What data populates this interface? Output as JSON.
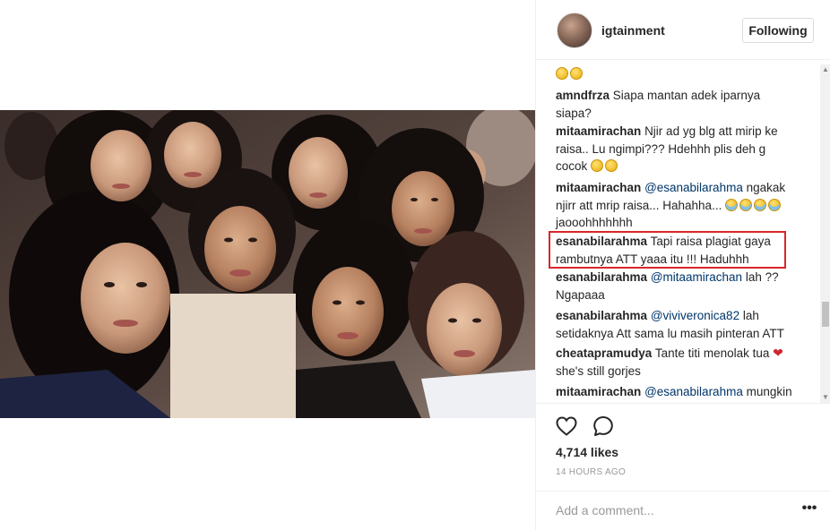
{
  "header": {
    "username": "igtainment",
    "follow_label": "Following"
  },
  "comments": [
    {
      "user": "",
      "parts": [],
      "emoji": [
        "yellow",
        "yellow"
      ]
    },
    {
      "user": "amndfrza",
      "line1": "Siapa mantan adek iparnya",
      "line2": "siapa?"
    },
    {
      "user": "mitaamirachan",
      "line1": "Njir ad yg blg att mirip ke",
      "line2": "raisa.. Lu ngimpi??? Hdehhh plis deh g",
      "line3": "cocok"
    },
    {
      "user": "mitaamirachan",
      "mention": "@esanabilarahma",
      "line1": "ngakak",
      "line2": "njirr att mrip raisa... Hahahha...",
      "line3": "jaooohhhhhhh"
    },
    {
      "user": "esanabilarahma",
      "line1": "Tapi raisa plagiat gaya",
      "line2": "rambutnya ATT yaaa itu !!! Haduhhh"
    },
    {
      "user": "esanabilarahma",
      "mention": "@mitaamirachan",
      "line1": "lah ??",
      "line2": "Ngapaaa"
    },
    {
      "user": "esanabilarahma",
      "mention": "@viviveronica82",
      "line1": "lah",
      "line2": "setidaknya Att sama lu masih pinteran ATT"
    },
    {
      "user": "cheatapramudya",
      "line1": "Tante titi menolak tua",
      "line2": "she's still gorjes"
    },
    {
      "user": "mitaamirachan",
      "mention": "@esanabilarahma",
      "line1": "mungkin"
    }
  ],
  "actions": {
    "likes": "4,714 likes",
    "time_ago": "14 HOURS AGO",
    "comment_placeholder": "Add a comment...",
    "more_label": "•••"
  },
  "icons": {
    "like": "heart-icon",
    "comment": "comment-icon",
    "more": "more-options-icon"
  }
}
